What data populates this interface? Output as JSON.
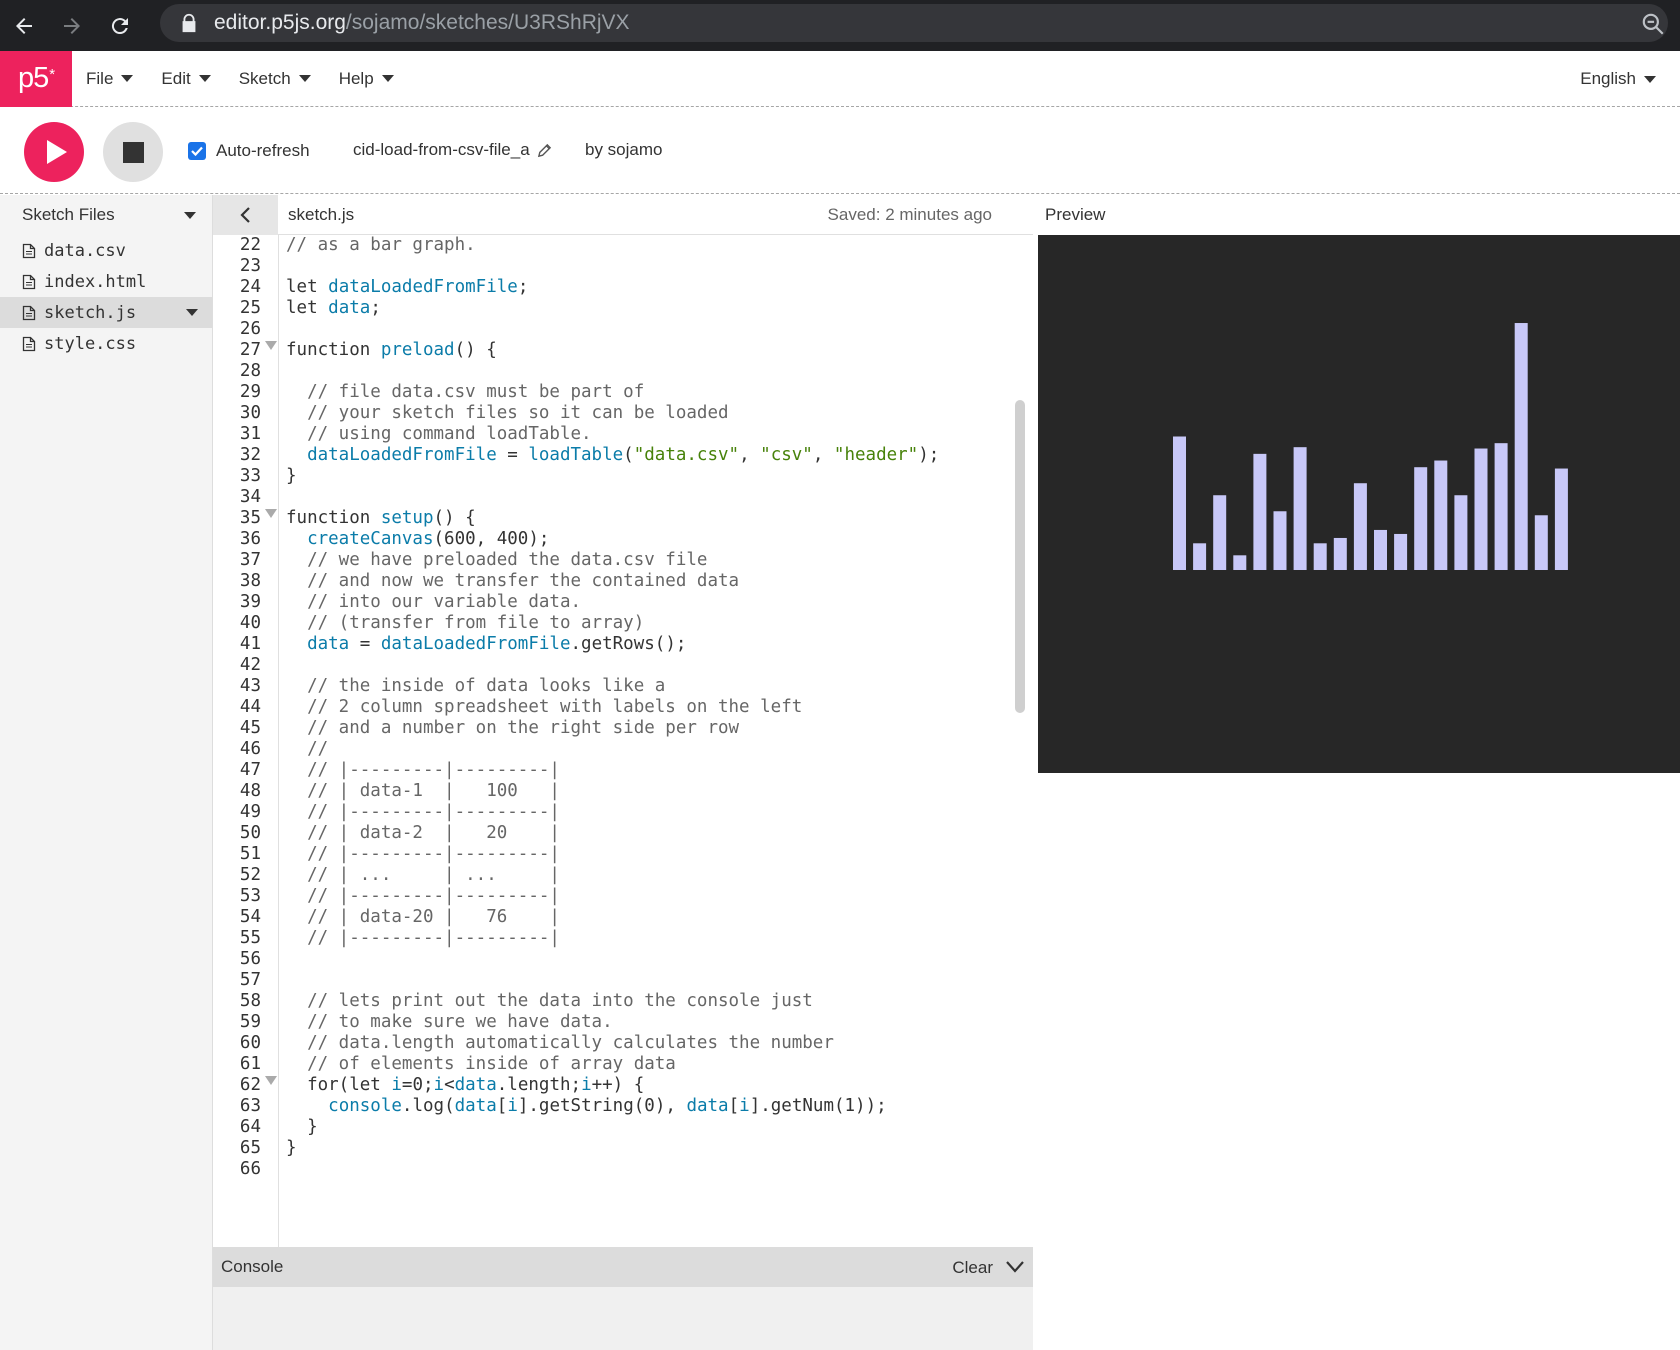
{
  "browser": {
    "url_host": "editor.p5js.org",
    "url_path": "/sojamo/sketches/U3RShRjVX"
  },
  "menubar": {
    "logo": "p5",
    "logo_sup": "*",
    "items": [
      "File",
      "Edit",
      "Sketch",
      "Help"
    ],
    "language": "English"
  },
  "toolbar": {
    "auto_refresh_label": "Auto-refresh",
    "auto_refresh_checked": true,
    "sketch_name": "cid-load-from-csv-file_a",
    "owner": "by sojamo"
  },
  "sidebar": {
    "title": "Sketch Files",
    "files": [
      "data.csv",
      "index.html",
      "sketch.js",
      "style.css"
    ],
    "active_file": "sketch.js"
  },
  "editor": {
    "tab_name": "sketch.js",
    "saved_status": "Saved: 2 minutes ago",
    "lines": [
      {
        "n": "22",
        "code": "// as a bar graph."
      },
      {
        "n": "23",
        "code": ""
      },
      {
        "n": "24",
        "code": "let dataLoadedFromFile;"
      },
      {
        "n": "25",
        "code": "let data;"
      },
      {
        "n": "26",
        "code": ""
      },
      {
        "n": "27",
        "code": "function preload() {",
        "fold": true
      },
      {
        "n": "28",
        "code": ""
      },
      {
        "n": "29",
        "code": "  // file data.csv must be part of"
      },
      {
        "n": "30",
        "code": "  // your sketch files so it can be loaded"
      },
      {
        "n": "31",
        "code": "  // using command loadTable."
      },
      {
        "n": "32",
        "code": "  dataLoadedFromFile = loadTable(\"data.csv\", \"csv\", \"header\");"
      },
      {
        "n": "33",
        "code": "}"
      },
      {
        "n": "34",
        "code": ""
      },
      {
        "n": "35",
        "code": "function setup() {",
        "fold": true
      },
      {
        "n": "36",
        "code": "  createCanvas(600, 400);"
      },
      {
        "n": "37",
        "code": "  // we have preloaded the data.csv file"
      },
      {
        "n": "38",
        "code": "  // and now we transfer the contained data"
      },
      {
        "n": "39",
        "code": "  // into our variable data."
      },
      {
        "n": "40",
        "code": "  // (transfer from file to array)"
      },
      {
        "n": "41",
        "code": "  data = dataLoadedFromFile.getRows();"
      },
      {
        "n": "42",
        "code": ""
      },
      {
        "n": "43",
        "code": "  // the inside of data looks like a"
      },
      {
        "n": "44",
        "code": "  // 2 column spreadsheet with labels on the left"
      },
      {
        "n": "45",
        "code": "  // and a number on the right side per row"
      },
      {
        "n": "46",
        "code": "  //"
      },
      {
        "n": "47",
        "code": "  // |---------|---------|"
      },
      {
        "n": "48",
        "code": "  // | data-1  |   100   |"
      },
      {
        "n": "49",
        "code": "  // |---------|---------|"
      },
      {
        "n": "50",
        "code": "  // | data-2  |   20    |"
      },
      {
        "n": "51",
        "code": "  // |---------|---------|"
      },
      {
        "n": "52",
        "code": "  // | ...     | ...     |"
      },
      {
        "n": "53",
        "code": "  // |---------|---------|"
      },
      {
        "n": "54",
        "code": "  // | data-20 |   76    |"
      },
      {
        "n": "55",
        "code": "  // |---------|---------|"
      },
      {
        "n": "56",
        "code": ""
      },
      {
        "n": "57",
        "code": ""
      },
      {
        "n": "58",
        "code": "  // lets print out the data into the console just"
      },
      {
        "n": "59",
        "code": "  // to make sure we have data."
      },
      {
        "n": "60",
        "code": "  // data.length automatically calculates the number"
      },
      {
        "n": "61",
        "code": "  // of elements inside of array data"
      },
      {
        "n": "62",
        "code": "  for(let i=0;i<data.length;i++) {",
        "fold": true
      },
      {
        "n": "63",
        "code": "    console.log(data[i].getString(0), data[i].getNum(1));"
      },
      {
        "n": "64",
        "code": "  }"
      },
      {
        "n": "65",
        "code": "}"
      },
      {
        "n": "66",
        "code": ""
      }
    ]
  },
  "preview": {
    "title": "Preview",
    "bar_color": "#c8c8f8",
    "bar_values": [
      100,
      20,
      56,
      11,
      87,
      44,
      92,
      20,
      24,
      65,
      30,
      27,
      77,
      82,
      56,
      91,
      95,
      185,
      41,
      76
    ]
  },
  "console": {
    "title": "Console",
    "clear_label": "Clear"
  },
  "colors": {
    "brand": "#ed225d",
    "comment": "#666666",
    "variable": "#0b7ca9",
    "string": "#47820a"
  }
}
